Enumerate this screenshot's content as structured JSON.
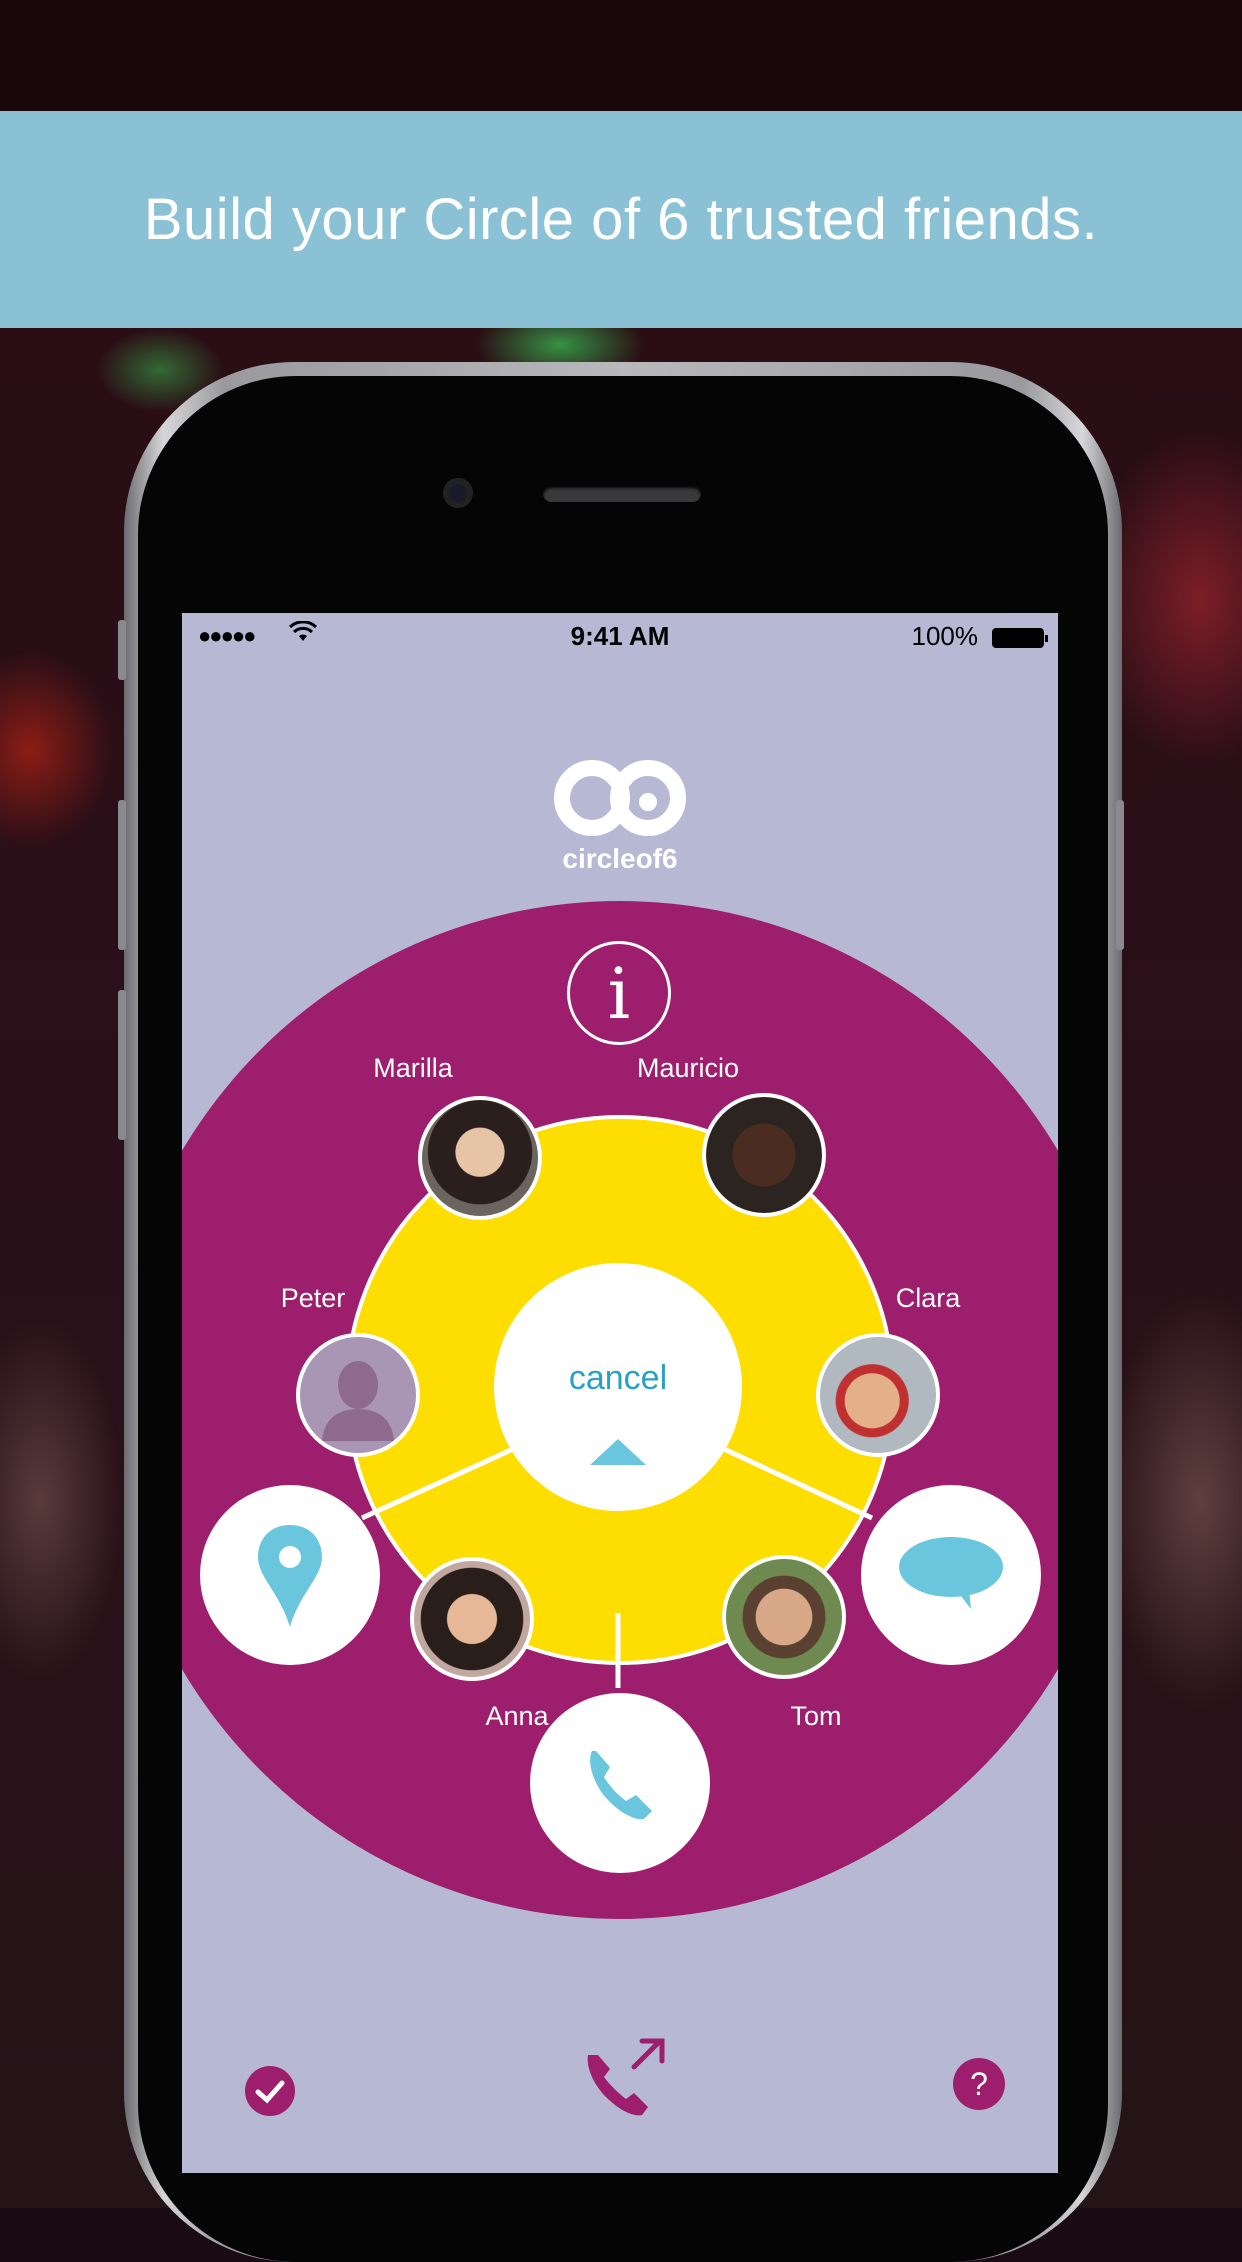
{
  "banner": {
    "text": "Build your Circle of 6 trusted friends."
  },
  "status_bar": {
    "time": "9:41 AM",
    "battery": "100%",
    "signal": "●●●●●",
    "wifi": "wifi-icon"
  },
  "app": {
    "logo_text": "circleof6",
    "info_symbol": "i",
    "center_button": {
      "label": "cancel"
    },
    "contacts": [
      {
        "name": "Marilla"
      },
      {
        "name": "Mauricio"
      },
      {
        "name": "Peter"
      },
      {
        "name": "Clara"
      },
      {
        "name": "Anna"
      },
      {
        "name": "Tom"
      }
    ],
    "actions": [
      "location-pin-icon",
      "chat-bubble-icon",
      "phone-icon"
    ],
    "bottom_bar": [
      "checkmark-icon",
      "phone-outgoing-icon",
      "help-icon"
    ]
  },
  "colors": {
    "banner": "#8bc1d4",
    "screen_bg": "#b7b8d4",
    "outer_ring": "#9e1e6e",
    "inner_circle": "#fedd00",
    "accent_blue": "#6ac6dc",
    "text_blue": "#2aa0c4"
  }
}
